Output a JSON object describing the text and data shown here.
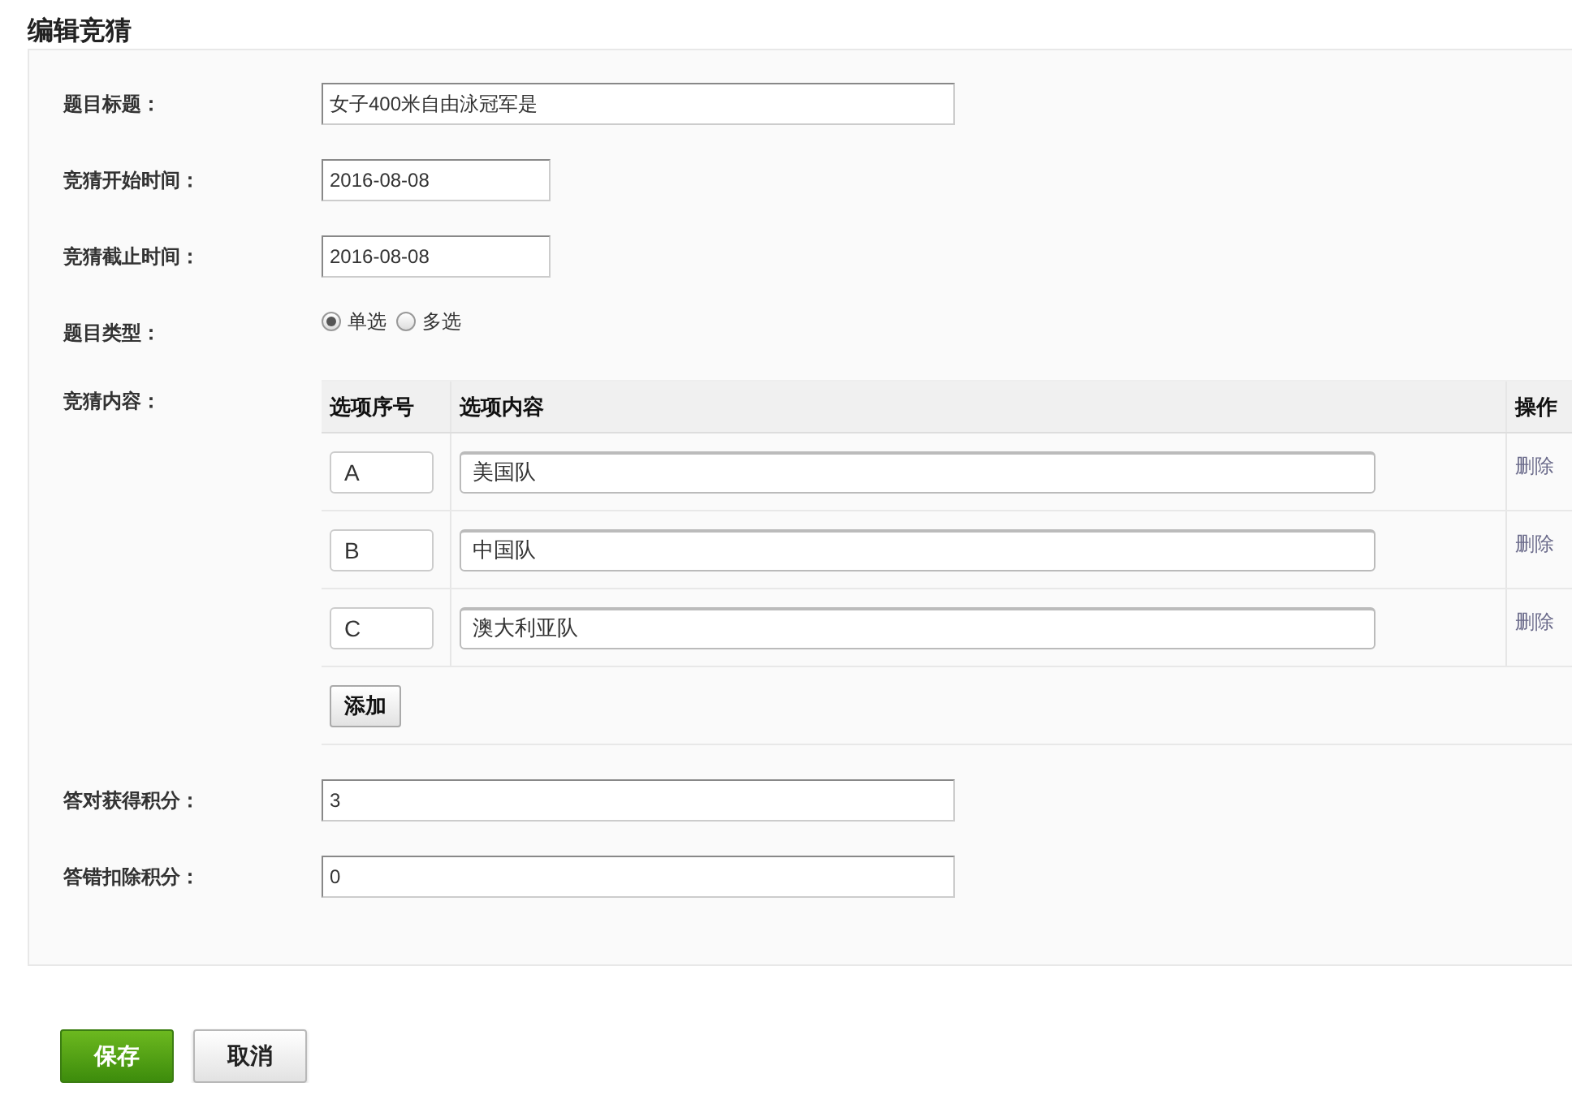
{
  "page_title": "编辑竞猜",
  "fields": [
    {
      "kind": "text",
      "label": "题目标题：",
      "value": "女子400米自由泳冠军是"
    },
    {
      "kind": "date",
      "label": "竞猜开始时间：",
      "value": "2016-08-08"
    },
    {
      "kind": "date",
      "label": "竞猜截止时间：",
      "value": "2016-08-08"
    },
    {
      "kind": "radio",
      "label": "题目类型：",
      "options": [
        {
          "label": "单选",
          "selected": true
        },
        {
          "label": "多选",
          "selected": false
        }
      ]
    },
    {
      "kind": "table",
      "label": "竞猜内容：",
      "columns": [
        "选项序号",
        "选项内容",
        "操作"
      ],
      "rows": [
        {
          "code": "A",
          "content": "美国队",
          "action": "删除"
        },
        {
          "code": "B",
          "content": "中国队",
          "action": "删除"
        },
        {
          "code": "C",
          "content": "澳大利亚队",
          "action": "删除"
        }
      ],
      "add_button": "添加"
    },
    {
      "kind": "text",
      "label": "答对获得积分：",
      "value": "3"
    },
    {
      "kind": "text",
      "label": "答错扣除积分：",
      "value": "0"
    }
  ],
  "buttons": [
    {
      "label": "保存",
      "kind": "primary"
    },
    {
      "label": "取消",
      "kind": "default"
    }
  ]
}
